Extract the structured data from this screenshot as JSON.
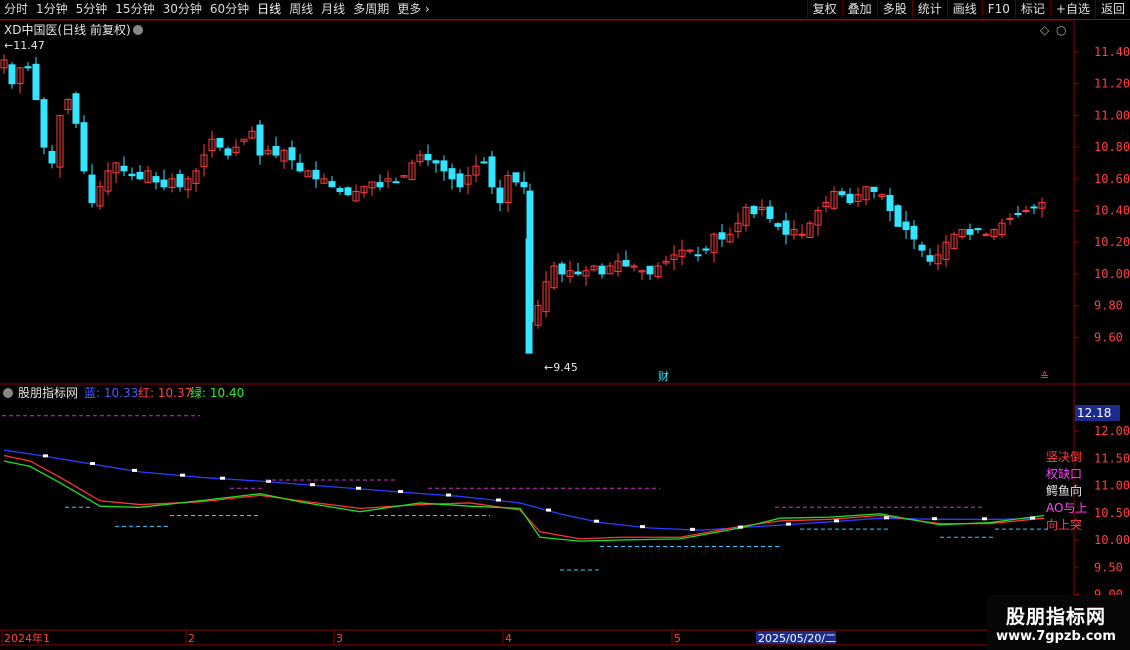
{
  "toolbar": {
    "tabs": [
      "分时",
      "1分钟",
      "5分钟",
      "15分钟",
      "30分钟",
      "60分钟",
      "日线",
      "周线",
      "月线",
      "多周期",
      "更多"
    ],
    "active_tab": "日线",
    "right_buttons": [
      "复权",
      "叠加",
      "多股",
      "统计",
      "画线",
      "F10",
      "标记",
      "+自选",
      "返回"
    ]
  },
  "main_panel": {
    "title": "XD中国医(日线 前复权)",
    "price_axis": [
      "11.40",
      "11.20",
      "11.00",
      "10.80",
      "10.60",
      "10.40",
      "10.20",
      "10.00",
      "9.80",
      "9.60"
    ],
    "high_label": "11.47",
    "low_label": "9.45",
    "finance_marker": "财",
    "s_marker": "S"
  },
  "indicator_panel": {
    "name": "股朋指标网",
    "blue_label": "蓝:",
    "blue_value": "10.33",
    "red_label": "红:",
    "red_value": "10.37",
    "green_label": "绿:",
    "green_value": "10.40",
    "axis": [
      "12.00",
      "11.50",
      "11.00",
      "10.50",
      "10.00",
      "9.50",
      "9.00"
    ],
    "current_value": "12.18",
    "right_notes": [
      "竖决倒",
      "权缺口",
      "鳄鱼向",
      "AO与上",
      "向上突"
    ]
  },
  "date_axis": {
    "labels": [
      "2024年1",
      "2",
      "3",
      "4",
      "5"
    ],
    "highlight": "2025/05/20/二"
  },
  "watermark": {
    "title": "股朋指标网",
    "url": "www.7gpzb.com"
  },
  "colors": {
    "up": "#ff3b3b",
    "down": "#33e5ff",
    "blue_line": "#2a3cff",
    "red_line": "#ff3333",
    "green_line": "#22dd22",
    "grid": "#8b0000"
  }
}
